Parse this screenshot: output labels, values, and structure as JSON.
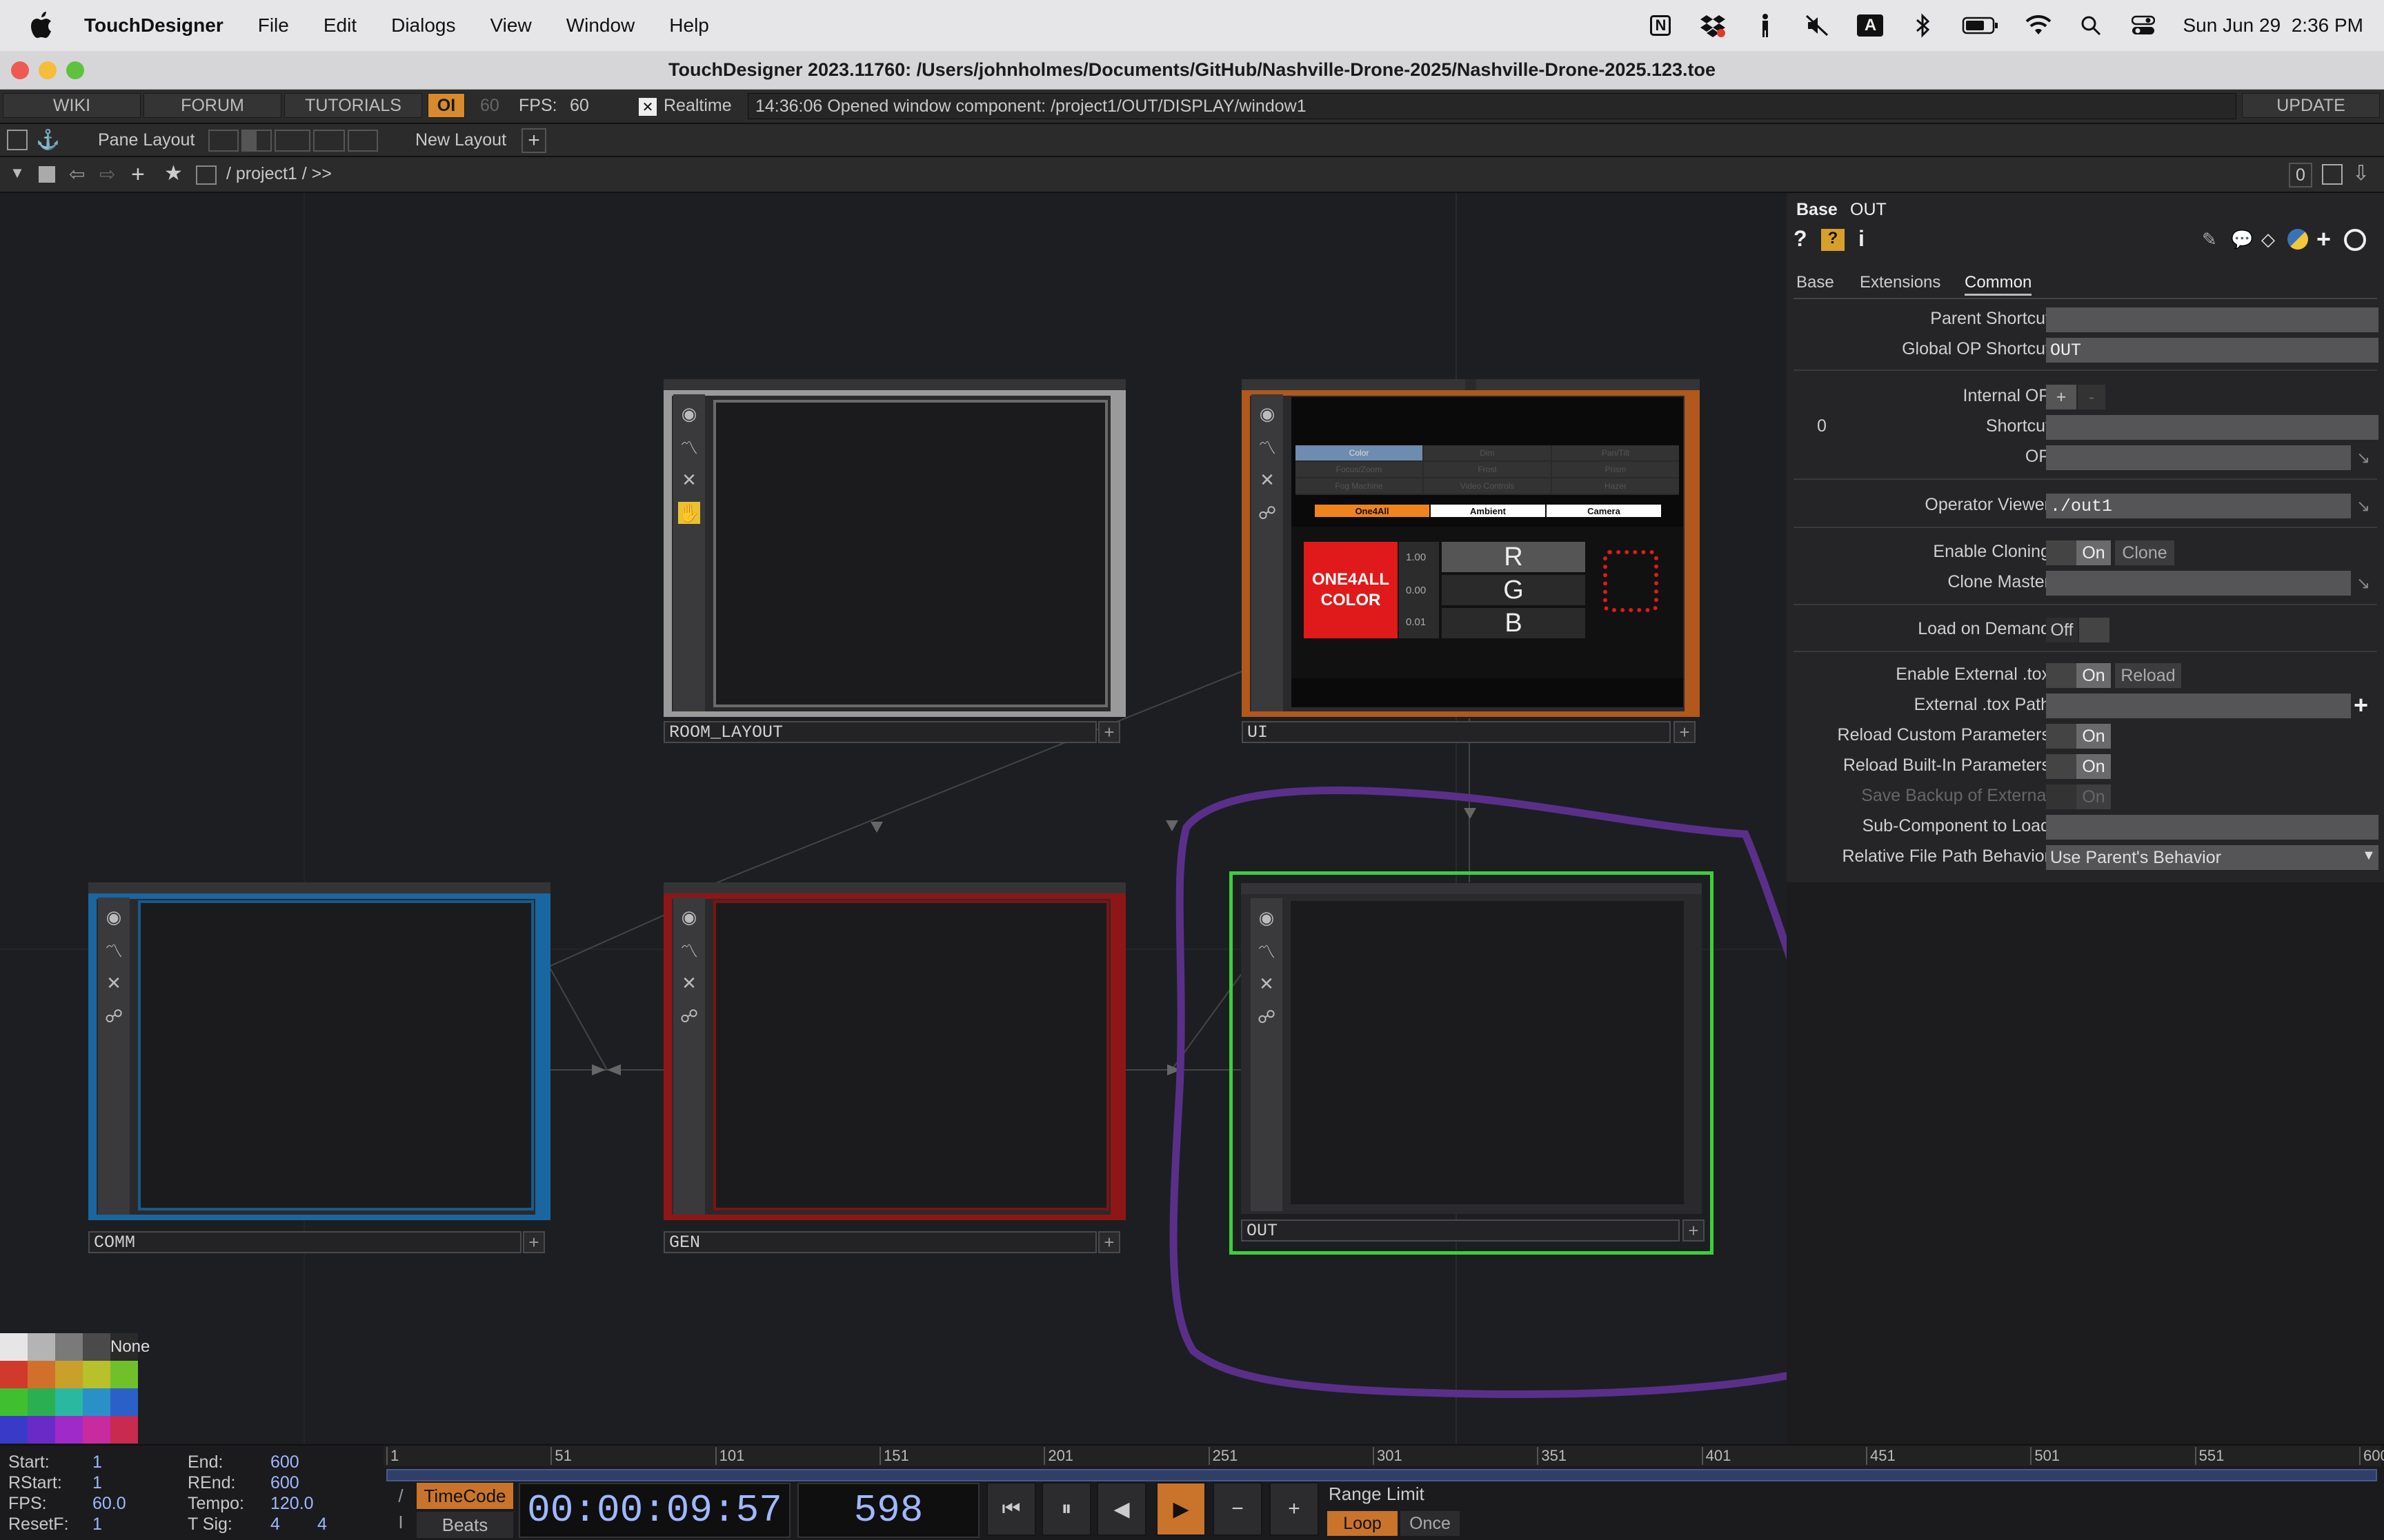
{
  "menubar": {
    "app": "TouchDesigner",
    "items": [
      "File",
      "Edit",
      "Dialogs",
      "View",
      "Window",
      "Help"
    ],
    "clock": "Sun Jun 29  2:36 PM",
    "status_icons": [
      "notion-icon",
      "dropbox-icon",
      "accessibility-icon",
      "mute-icon",
      "input-source-icon",
      "bluetooth-icon",
      "battery-icon",
      "wifi-icon",
      "spotlight-icon",
      "control-center-icon"
    ],
    "input_letter": "A",
    "notion_letter": "N"
  },
  "window": {
    "title": "TouchDesigner 2023.11760: /Users/johnholmes/Documents/GitHub/Nashville-Drone-2025/Nashville-Drone-2025.123.toe"
  },
  "toolbar": {
    "wiki": "WIKI",
    "forum": "FORUM",
    "tutorials": "TUTORIALS",
    "oi": "OI",
    "fps_target": "60",
    "fps_label": "FPS:",
    "fps_value": "60",
    "realtime_label": "Realtime",
    "realtime_mark": "✕",
    "message": "14:36:06 Opened window component: /project1/OUT/DISPLAY/window1",
    "update": "UPDATE"
  },
  "layoutbar": {
    "pane_layout": "Pane Layout",
    "new_layout": "New Layout",
    "add": "+"
  },
  "pathbar": {
    "path": "/ project1 / >>",
    "counter": "0"
  },
  "network": {
    "comps": [
      {
        "name": "ROOM_LAYOUT"
      },
      {
        "name": "UI"
      },
      {
        "name": "COMM"
      },
      {
        "name": "GEN"
      },
      {
        "name": "OUT"
      }
    ],
    "ui_preview": {
      "tabs_row1": [
        "Color",
        "Dim",
        "Pan/Tilt"
      ],
      "tabs_row2": [
        "Focus/Zoom",
        "Frost",
        "Prism"
      ],
      "tabs_row3": [
        "Fog Machine",
        "Video Controls",
        "Hazer"
      ],
      "modes": [
        "One4All",
        "Ambient",
        "Camera"
      ],
      "color_box": "ONE4ALL COLOR",
      "values": [
        "1.00",
        "0.00",
        "0.01"
      ],
      "channels": [
        "R",
        "G",
        "B"
      ]
    }
  },
  "params": {
    "type": "Base",
    "name": "OUT",
    "tabs": [
      "Base",
      "Extensions",
      "Common"
    ],
    "active_tab": "Common",
    "rows": {
      "parent_shortcut": {
        "label": "Parent Shortcut",
        "value": ""
      },
      "global_op_shortcut": {
        "label": "Global OP Shortcut",
        "value": "OUT"
      },
      "internal_op": {
        "label": "Internal OP",
        "plus": "+",
        "minus": "-"
      },
      "index": "0",
      "shortcut": {
        "label": "Shortcut",
        "value": ""
      },
      "op": {
        "label": "OP",
        "value": ""
      },
      "operator_viewer": {
        "label": "Operator Viewer",
        "value": "./out1"
      },
      "enable_cloning": {
        "label": "Enable Cloning",
        "toggle": "On",
        "button": "Clone"
      },
      "clone_master": {
        "label": "Clone Master",
        "value": ""
      },
      "load_on_demand": {
        "label": "Load on Demand",
        "toggle": "Off"
      },
      "enable_external_tox": {
        "label": "Enable External .tox",
        "toggle": "On",
        "button": "Reload"
      },
      "external_tox_path": {
        "label": "External .tox Path",
        "value": ""
      },
      "reload_custom": {
        "label": "Reload Custom Parameters",
        "toggle": "On"
      },
      "reload_builtin": {
        "label": "Reload Built-In Parameters",
        "toggle": "On"
      },
      "save_backup": {
        "label": "Save Backup of External",
        "toggle": "On"
      },
      "sub_component": {
        "label": "Sub-Component to Load",
        "value": ""
      },
      "relative_path": {
        "label": "Relative File Path Behavior",
        "value": "Use Parent's Behavior"
      }
    }
  },
  "palette": {
    "none_label": "None",
    "colors": [
      "#e6e6e6",
      "#b4b4b4",
      "#7a7a7a",
      "#4a4a4a",
      "#2a2a2a",
      "#d03a2a",
      "#d0702a",
      "#c8a02a",
      "#b8c02a",
      "#70c02a",
      "#40c030",
      "#2ab050",
      "#2ab8a0",
      "#2a90c8",
      "#2a60c8",
      "#3a3ac8",
      "#6a2ac8",
      "#a02ac8",
      "#c82aa0",
      "#c82a50"
    ]
  },
  "timeline": {
    "start_label": "Start:",
    "start": "1",
    "end_label": "End:",
    "end": "600",
    "rstart_label": "RStart:",
    "rstart": "1",
    "rend_label": "REnd:",
    "rend": "600",
    "fps_label": "FPS:",
    "fps": "60.0",
    "tempo_label": "Tempo:",
    "tempo": "120.0",
    "resetf_label": "ResetF:",
    "resetf": "1",
    "tsig_label": "T Sig:",
    "tsig_a": "4",
    "tsig_b": "4",
    "ticks": [
      "1",
      "51",
      "101",
      "151",
      "201",
      "251",
      "301",
      "351",
      "401",
      "451",
      "501",
      "551",
      "600"
    ],
    "timecode_label": "TimeCode",
    "beats_label": "Beats",
    "timecode": "00:00:09:57",
    "frame": "598",
    "range_limit": "Range Limit",
    "loop": "Loop",
    "once": "Once",
    "slash": "/",
    "bar": "I"
  }
}
